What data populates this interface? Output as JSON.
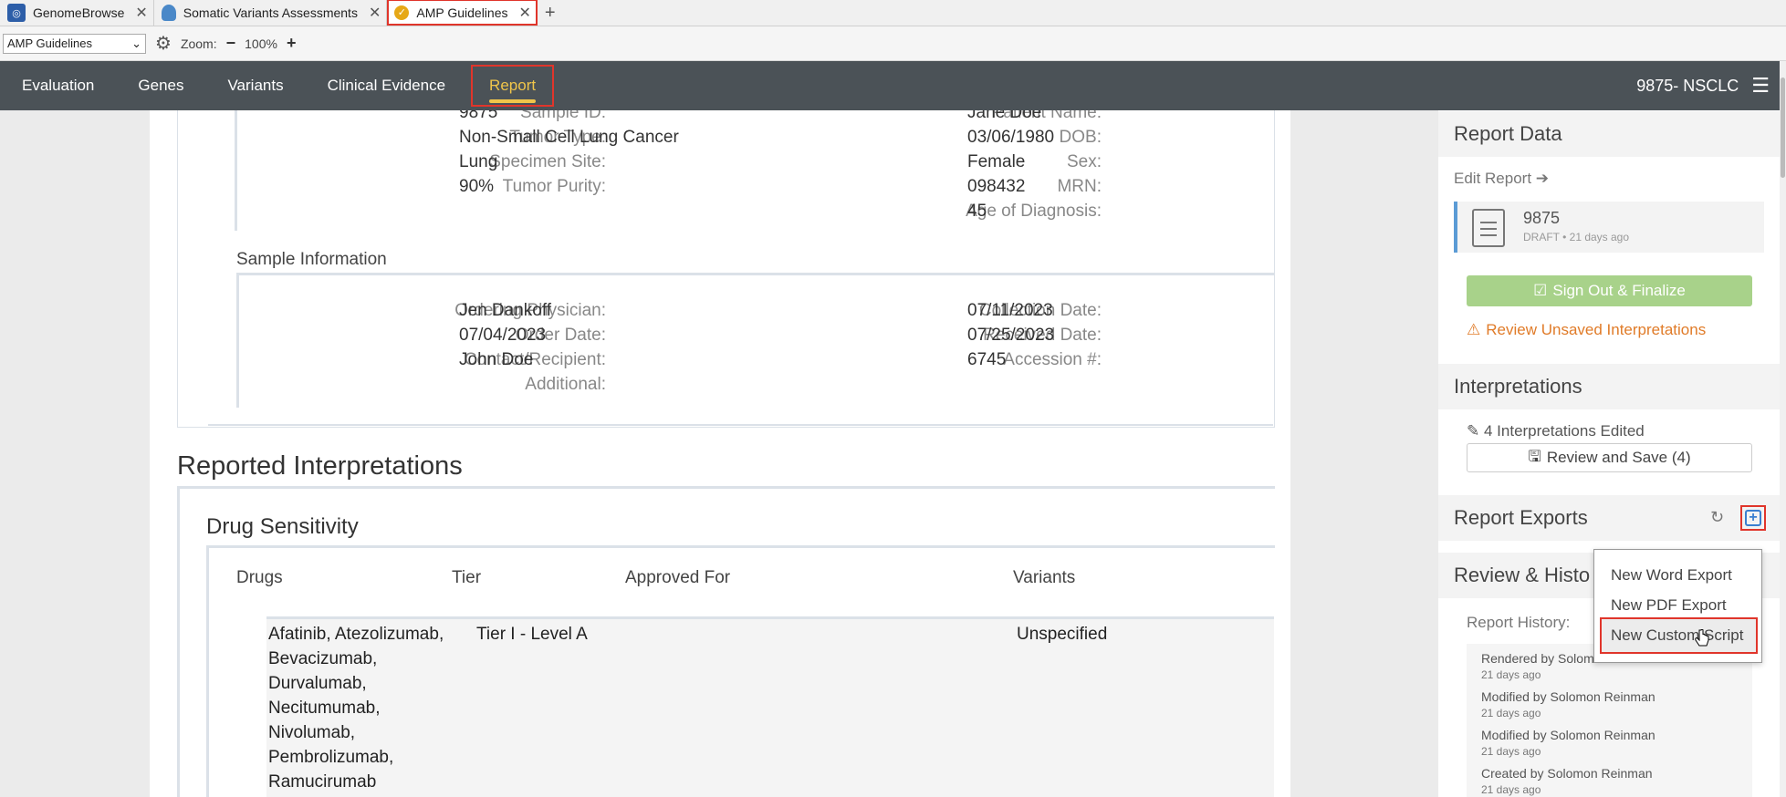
{
  "browser_tabs": [
    {
      "label": "GenomeBrowse",
      "icon": "genome-icon",
      "active": false
    },
    {
      "label": "Somatic Variants Assessments",
      "icon": "database-icon",
      "active": false
    },
    {
      "label": "AMP Guidelines",
      "icon": "amp-icon",
      "active": true
    }
  ],
  "toolbar": {
    "project_select": "AMP Guidelines",
    "zoom_label": "Zoom:",
    "zoom_value": "100%",
    "zoom_out": "−",
    "zoom_in": "+"
  },
  "nav": {
    "items": [
      "Evaluation",
      "Genes",
      "Variants",
      "Clinical Evidence",
      "Report"
    ],
    "active": "Report",
    "sample_title": "9875- NSCLC"
  },
  "patient": {
    "sample_id_label": "Sample ID:",
    "sample_id": "9875",
    "tumor_type_label": "Tumor Type:",
    "tumor_type": "Non-Small Cell Lung Cancer",
    "specimen_site_label": "Specimen Site:",
    "specimen_site": "Lung",
    "tumor_purity_label": "Tumor Purity:",
    "tumor_purity": "90%",
    "patient_name_label": "Patient Name:",
    "patient_name": "Jane Doe",
    "dob_label": "DOB:",
    "dob": "03/06/1980",
    "sex_label": "Sex:",
    "sex": "Female",
    "mrn_label": "MRN:",
    "mrn": "098432",
    "age_label": "Age of Diagnosis:",
    "age": "45"
  },
  "sample_info": {
    "heading": "Sample Information",
    "ordering_physician_label": "Ordering Physician:",
    "ordering_physician": "Jen Dankoff",
    "order_date_label": "Order Date:",
    "order_date": "07/04/2023",
    "contact_label": "Contact/Recipient:",
    "contact": "John Doe",
    "additional_label": "Additional:",
    "collection_date_label": "Collection Date:",
    "collection_date": "07/11/2023",
    "received_date_label": "Received Date:",
    "received_date": "07/25/2023",
    "accession_label": "Accession #:",
    "accession": "6745"
  },
  "interpretations_section": {
    "title": "Reported Interpretations",
    "subtitle": "Drug Sensitivity",
    "columns": [
      "Drugs",
      "Tier",
      "Approved For",
      "Variants"
    ],
    "row": {
      "drugs": [
        "Afatinib, Atezolizumab,",
        "Bevacizumab,",
        "Durvalumab,",
        "Necitumumab,",
        "Nivolumab,",
        "Pembrolizumab,",
        "Ramucirumab"
      ],
      "tier": "Tier I - Level A",
      "variants": "Unspecified"
    }
  },
  "sidebar": {
    "report_data_title": "Report Data",
    "edit_report": "Edit Report",
    "report_name": "9875",
    "report_status": "DRAFT • 21 days ago",
    "sign_out_button": "Sign Out & Finalize",
    "review_unsaved": "Review Unsaved Interpretations",
    "interpretations_title": "Interpretations",
    "interpretations_edited": "4 Interpretations Edited",
    "review_save_button": "Review and Save (4)",
    "exports_title": "Report Exports",
    "review_history_title": "Review & Histo",
    "report_history_label": "Report History:",
    "history": [
      {
        "action": "Rendered by Solom",
        "time": "21 days ago"
      },
      {
        "action": "Modified by Solomon Reinman",
        "time": "21 days ago"
      },
      {
        "action": "Modified by Solomon Reinman",
        "time": "21 days ago"
      },
      {
        "action": "Created by Solomon Reinman",
        "time": "21 days ago"
      }
    ]
  },
  "export_menu": [
    "New Word Export",
    "New PDF Export",
    "New Custom Script"
  ],
  "colors": {
    "nav_bg": "#4b5257",
    "accent_gold": "#f0c54a",
    "highlight_red": "#e0352b",
    "success_green": "#a8d28a",
    "warning_orange": "#e07b28"
  }
}
